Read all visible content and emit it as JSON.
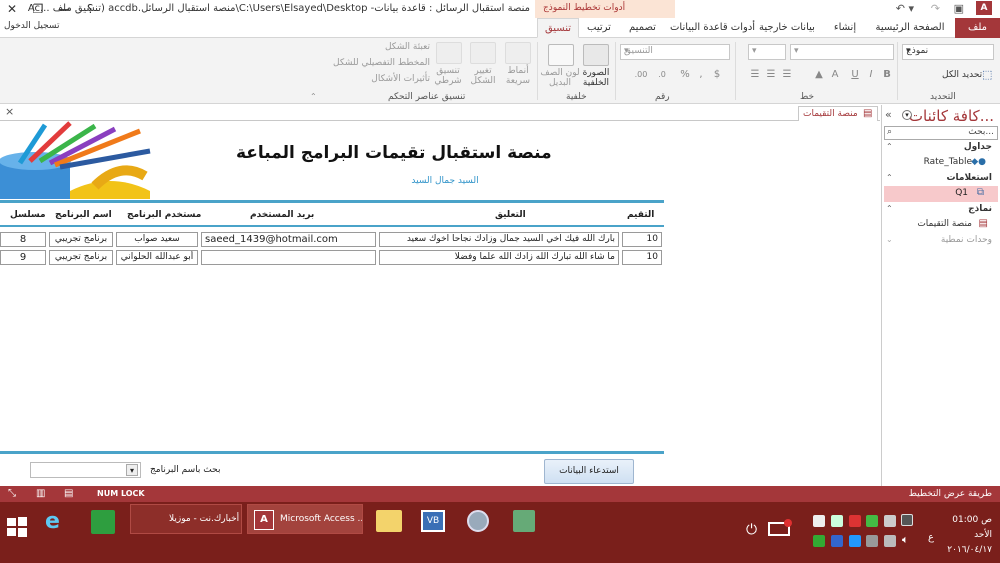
{
  "window": {
    "title": "منصة استقبال الرسائل : قاعدة بيانات- C:\\Users\\Elsayed\\Desktop\\منصة استقبال الرسائل.accdb (تنسيق ملف ...Ac",
    "login_label": "تسجيل الدخول",
    "context_tab_group": "أدوات تخطيط النموذج",
    "help": "؟",
    "minimize": "—",
    "restore": "❐",
    "close": "✕"
  },
  "tabs": [
    {
      "label": "ملف"
    },
    {
      "label": "الصفحة الرئيسية"
    },
    {
      "label": "إنشاء"
    },
    {
      "label": "بيانات خارجية"
    },
    {
      "label": "أدوات قاعدة البيانات"
    },
    {
      "label": "تصميم"
    },
    {
      "label": "ترتيب"
    },
    {
      "label": "تنسيق"
    }
  ],
  "ribbon": {
    "selection_group": {
      "combo_value": "نموذج",
      "select_all": "تحديد الكل",
      "label": "التحديد"
    },
    "font_group": {
      "label": "خط"
    },
    "number_group": {
      "format_combo": "التنسيق",
      "label": "رقم"
    },
    "background_group": {
      "image_label": "الصورة\nالخلفية",
      "alt_row_label": "لون الصف\nالبديل",
      "label": "خلفية"
    },
    "control_group": {
      "styles": "أنماط\nسريعة",
      "change_shape": "تغيير\nالشكل",
      "cond_format": "تنسيق\nشرطي",
      "fill": "تعبئة الشكل",
      "outline": "المخطط التفصيلي للشكل",
      "effects": "تأثيرات الأشكال",
      "label": "تنسيق عناصر التحكم"
    }
  },
  "nav": {
    "header": "كافة كائنات...",
    "search_placeholder": "بحث...",
    "sections": [
      {
        "title": "جداول",
        "items": [
          "Rate_Table"
        ]
      },
      {
        "title": "استعلامات",
        "items": [
          "Q1"
        ]
      },
      {
        "title": "نماذج",
        "items": [
          "منصة التقيمات"
        ]
      },
      {
        "title": "وحدات نمطية",
        "items": []
      }
    ]
  },
  "document": {
    "tab_label": "منصة التقيمات",
    "close": "×",
    "form_title": "منصة استقبال تقيمات البرامج المباعة",
    "form_subtitle": "السيد جمال السيد",
    "columns": {
      "rating": "التقيم",
      "comment": "التعليق",
      "user_email": "بريد المستخدم",
      "program_user": "مستخدم البرنامج",
      "program_name": "اسم البرنامج",
      "serial": "مسلسل"
    },
    "rows": [
      {
        "rating": "10",
        "comment": "بارك الله فيك اخي السيد جمال وزادك نجاحا اخوك سعيد",
        "email": "saeed_1439@hotmail.com",
        "user": "سعيد صواب",
        "program": "برنامج تجريبي",
        "serial": "8"
      },
      {
        "rating": "10",
        "comment": "ما شاء الله تبارك الله زادك الله علما وفضلا",
        "email": "",
        "user": "أبو عبدالله الحلواني",
        "program": "برنامج تجريبي",
        "serial": "9"
      }
    ],
    "search_label": "بحث باسم البرنامج",
    "fetch_button": "استدعاء البيانات"
  },
  "statusbar": {
    "left": "NUM LOCK",
    "right": "طريقة عرض التخطيط"
  },
  "taskbar": {
    "tasks": [
      {
        "label": "Microsoft Access ..."
      },
      {
        "label": "أخبارك.نت - موزيلا ..."
      }
    ],
    "clock_time": "01:00 ص",
    "clock_day": "الأحد",
    "clock_date": "٢٠١٦/٠٤/١٧",
    "lang": "ع"
  },
  "colors": {
    "accent": "#a4373a",
    "taskbar": "#7a1f1b",
    "form_line": "#4aa3c9"
  }
}
